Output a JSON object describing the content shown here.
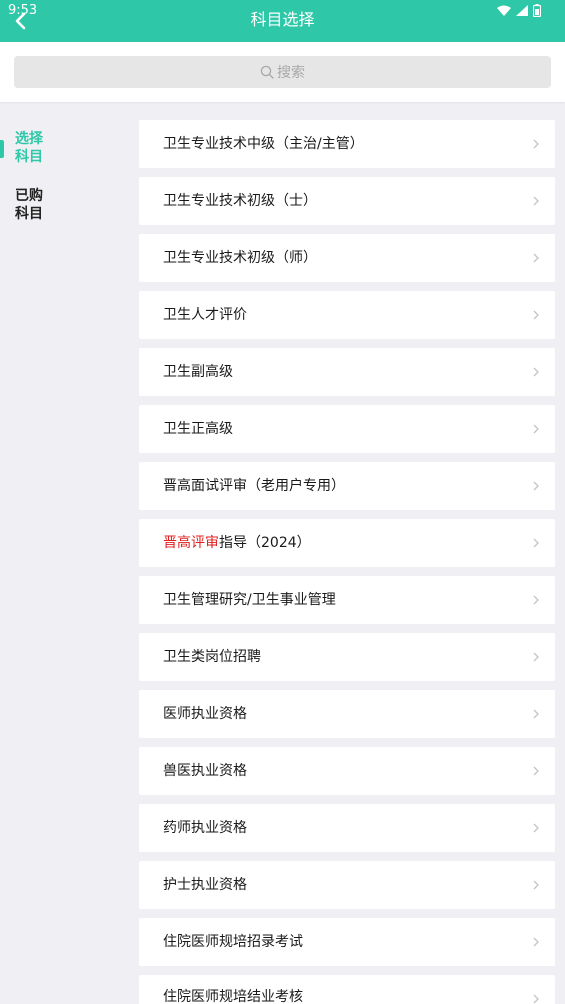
{
  "status_bar": {
    "time": "9:53"
  },
  "header": {
    "title": "科目选择"
  },
  "search": {
    "placeholder": "搜索"
  },
  "sidebar": {
    "tabs": [
      {
        "label": "选择科目",
        "active": true
      },
      {
        "label": "已购科目",
        "active": false
      }
    ]
  },
  "subjects": [
    {
      "label": "卫生专业技术中级（主治/主管）"
    },
    {
      "label": "卫生专业技术初级（士）"
    },
    {
      "label": "卫生专业技术初级（师）"
    },
    {
      "label": "卫生人才评价"
    },
    {
      "label": "卫生副高级"
    },
    {
      "label": "卫生正高级"
    },
    {
      "label": "晋高面试评审（老用户专用）"
    },
    {
      "label_highlight": "晋高评审",
      "label": "指导（2024）"
    },
    {
      "label": "卫生管理研究/卫生事业管理"
    },
    {
      "label": "卫生类岗位招聘"
    },
    {
      "label": "医师执业资格"
    },
    {
      "label": "兽医执业资格"
    },
    {
      "label": "药师执业资格"
    },
    {
      "label": "护士执业资格"
    },
    {
      "label": "住院医师规培招录考试"
    },
    {
      "label": "住院医师规培结业考核"
    }
  ],
  "colors": {
    "accent": "#2ec8a8",
    "highlight": "#e02020"
  }
}
